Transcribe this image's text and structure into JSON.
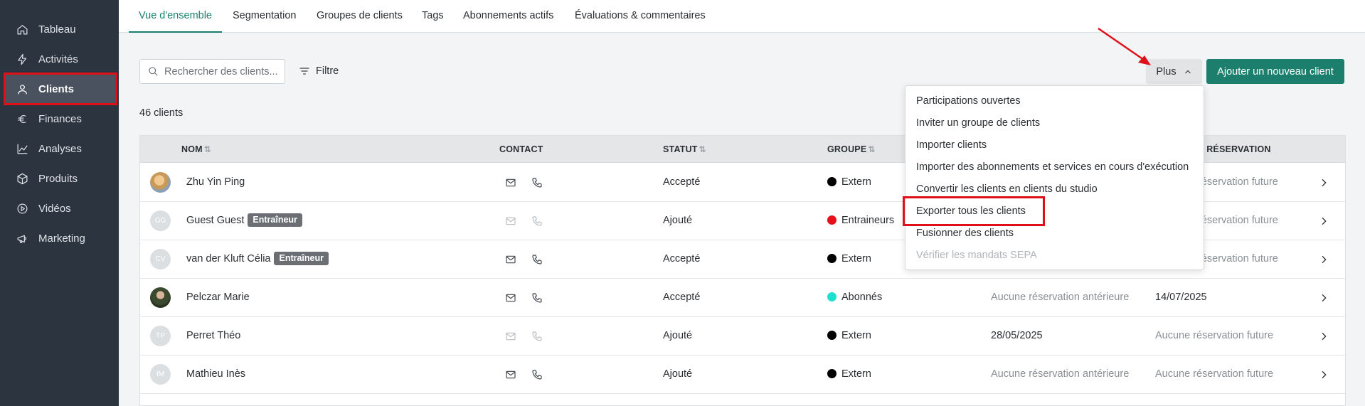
{
  "sidebar": {
    "items": [
      {
        "label": "Tableau",
        "icon": "home-icon"
      },
      {
        "label": "Activités",
        "icon": "lightning-icon"
      },
      {
        "label": "Clients",
        "icon": "user-icon"
      },
      {
        "label": "Finances",
        "icon": "euro-icon"
      },
      {
        "label": "Analyses",
        "icon": "chart-line-icon"
      },
      {
        "label": "Produits",
        "icon": "box-icon"
      },
      {
        "label": "Vidéos",
        "icon": "play-circle-icon"
      },
      {
        "label": "Marketing",
        "icon": "megaphone-icon"
      }
    ],
    "active": "Clients"
  },
  "tabs": [
    "Vue d'ensemble",
    "Segmentation",
    "Groupes de clients",
    "Tags",
    "Abonnements actifs",
    "Évaluations & commentaires"
  ],
  "toolbar": {
    "search_placeholder": "Rechercher des clients...",
    "filter_label": "Filtre",
    "more_label": "Plus",
    "add_label": "Ajouter un nouveau client"
  },
  "client_count": "46 clients",
  "table": {
    "headers": {
      "name": "NOM",
      "contact": "CONTACT",
      "status": "STATUT",
      "group": "GROUPE",
      "next_booking": "E RÉSERVATION"
    },
    "rows": [
      {
        "initials": "",
        "name": "Zhu Yin Ping",
        "badge": "",
        "status": "Accepté",
        "group": "Extern",
        "group_color": "#000000",
        "last": "",
        "next": "réservation future",
        "contact_active": true
      },
      {
        "initials": "GG",
        "name": "Guest Guest",
        "badge": "Entraîneur",
        "status": "Ajouté",
        "group": "Entraineurs",
        "group_color": "#e5101a",
        "last": "",
        "next": "réservation future",
        "contact_active": false
      },
      {
        "initials": "CV",
        "name": "van der Kluft Célia",
        "badge": "Entraîneur",
        "status": "Accepté",
        "group": "Extern",
        "group_color": "#000000",
        "last": "",
        "next": "réservation future",
        "contact_active": true
      },
      {
        "initials": "",
        "name": "Pelczar Marie",
        "badge": "",
        "status": "Accepté",
        "group": "Abonnés",
        "group_color": "#1de0d0",
        "last": "Aucune réservation antérieure",
        "next": "14/07/2025",
        "contact_active": true
      },
      {
        "initials": "TP",
        "name": "Perret Théo",
        "badge": "",
        "status": "Ajouté",
        "group": "Extern",
        "group_color": "#000000",
        "last": "28/05/2025",
        "next": "Aucune réservation future",
        "contact_active": false
      },
      {
        "initials": "IM",
        "name": "Mathieu Inès",
        "badge": "",
        "status": "Ajouté",
        "group": "Extern",
        "group_color": "#000000",
        "last": "Aucune réservation antérieure",
        "next": "Aucune réservation future",
        "contact_active": true
      }
    ]
  },
  "more_menu": {
    "items": [
      "Participations ouvertes",
      "Inviter un groupe de clients",
      "Importer clients",
      "Importer des abonnements et services en cours d'exécution",
      "Convertir les clients en clients du studio",
      "Exporter tous les clients",
      "Fusionner des clients",
      "Vérifier les mandats SEPA"
    ],
    "highlighted": "Exporter tous les clients",
    "disabled": "Vérifier les mandats SEPA"
  },
  "colors": {
    "accent": "#1c7f6d",
    "sidebar": "#2c3440",
    "annotation": "#e0101a"
  }
}
